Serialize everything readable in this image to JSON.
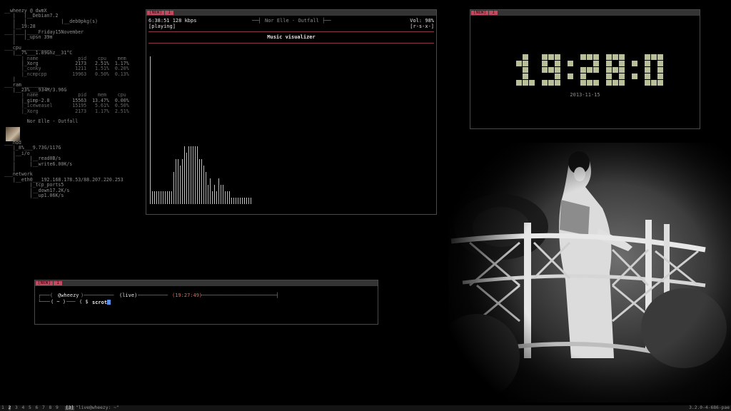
{
  "conky": {
    "lines": [
      "__wheezy @ dwmX",
      "   |   |__Debian7.2",
      "   |   |            |__deb0pkg(s)",
      "   |__19:28",
      "___|___|____Friday15November",
      "   |   |_upsn 39m",
      "   |",
      "___cpu___________",
      "   |__7%___1.89Ghz__31°C",
      "      | name              pid    cpu    mem",
      "      |_Xorg             2173   2.51%  1.17%",
      "      |_conky            1211   1.51%  0.20%",
      "      |_ncmpcpp         19963   0.50%  0.13%",
      "   |",
      "___ram ________",
      "   |__23%___934M/3.96G",
      "      | name              pid    mem    cpu",
      "      |_gimp-2.8        15563  13.47%  0.00%",
      "      |_iceweasel       15195   5.61%  0.50%",
      "      |_Xorg             2173   1.17%  2.51%",
      "",
      "        Nor Elle - Outfall",
      "",
      "",
      "",
      "___hdd",
      "   |_8%___9.73G/117G",
      "   |__i/o",
      "   |     |__read0B/s",
      "   |     |__write6.00K/s",
      "   |",
      "___network",
      "   |__eth0___192.168.178.53/88.207.220.253",
      "         |_tcp_ports5",
      "         |__down17.2K/s",
      "         |__up1.06K/s"
    ],
    "kernel": "3.2.0-4-686-pae"
  },
  "tags": {
    "new": "[NEW]",
    "one": "1"
  },
  "ncmpcpp": {
    "time": "6:38:51 128 kbps",
    "state": "[playing]",
    "song": "Nor Elle - Outfall",
    "volume": "Vol: 98%",
    "flags": "[r-s-x-]",
    "screen_title": "Music visualizer",
    "visualizer_levels": [
      23,
      2,
      2,
      2,
      2,
      2,
      2,
      2,
      2,
      2,
      2,
      5,
      7,
      7,
      6,
      7,
      9,
      8,
      9,
      9,
      9,
      9,
      9,
      7,
      7,
      6,
      5,
      3,
      4,
      2,
      3,
      2,
      4,
      3,
      3,
      2,
      2,
      2,
      1,
      1,
      1,
      1,
      1,
      1,
      1,
      1,
      1,
      1
    ]
  },
  "clock": {
    "time": "19:28:06",
    "date": "2013-11-15"
  },
  "terminal": {
    "user": "@wheezy",
    "status": "(live)",
    "time": "(19:27:49)",
    "dir": "( ~ )",
    "prompt": "( $",
    "command": "scrot"
  },
  "statusbar": {
    "workspaces": [
      "1",
      "2",
      "3",
      "4",
      "5",
      "6",
      "7",
      "8",
      "9"
    ],
    "layout": "[3]",
    "title": "\"live@wheezy: ~\"",
    "right": "3.2.0-4-686-pae"
  },
  "colors": {
    "tag": "#c24a5e",
    "clock": "#b9bf98",
    "accent_red": "#e06a54"
  }
}
